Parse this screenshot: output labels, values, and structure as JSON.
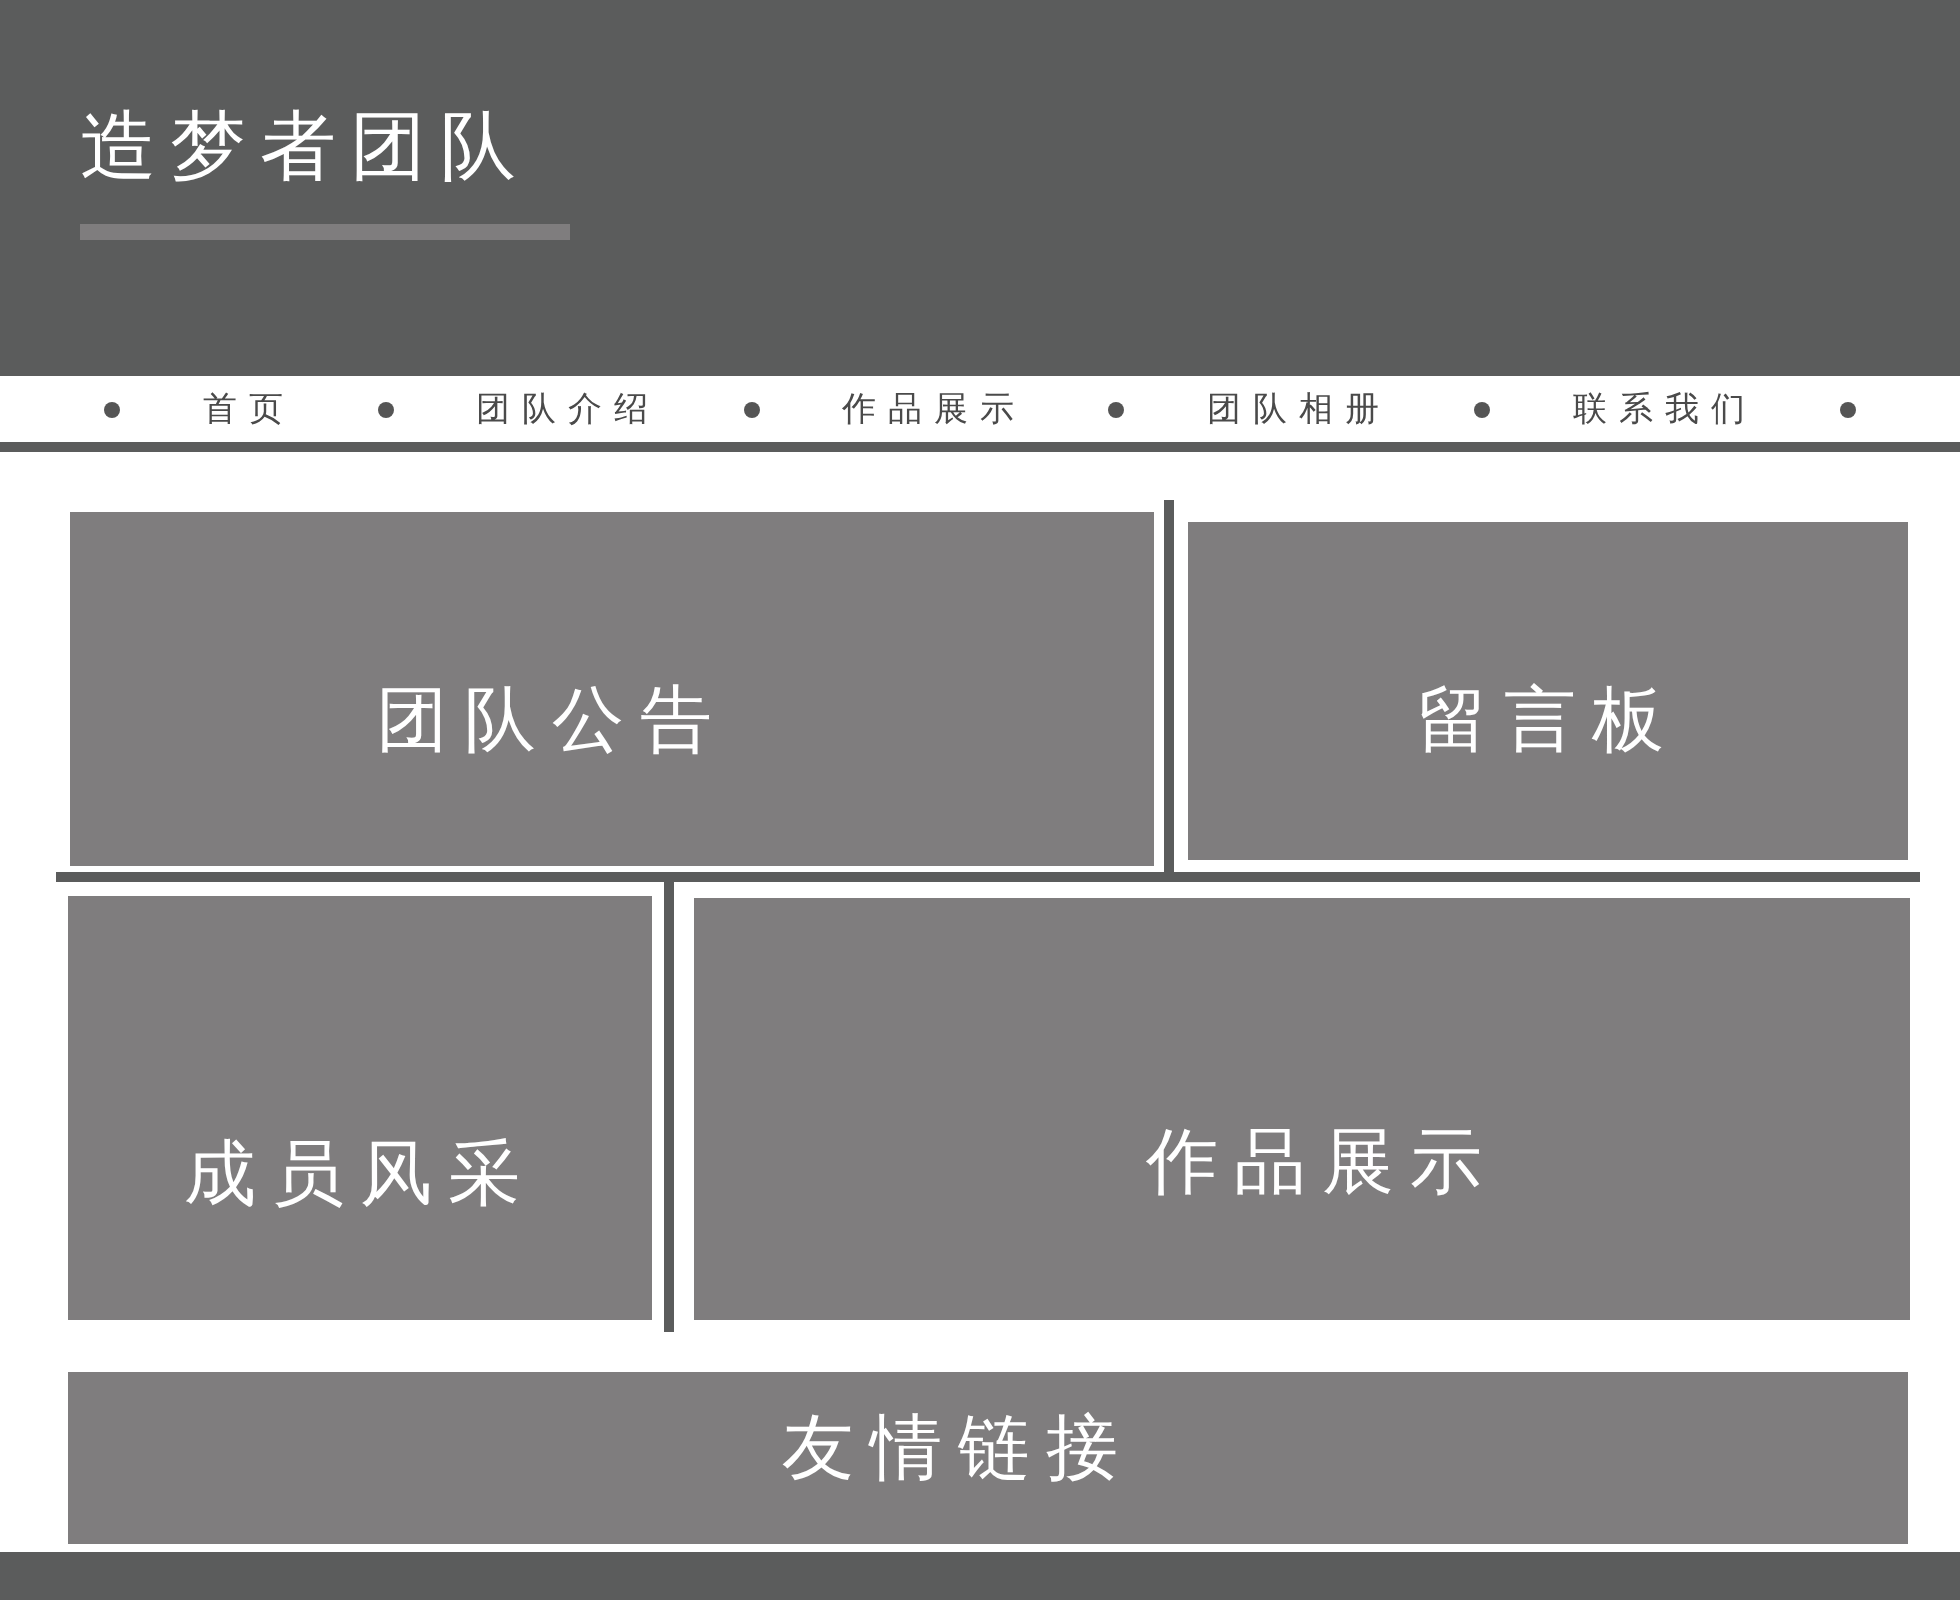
{
  "header": {
    "title": "造梦者团队"
  },
  "nav": {
    "items": [
      {
        "label": "首页"
      },
      {
        "label": "团队介绍"
      },
      {
        "label": "作品展示"
      },
      {
        "label": "团队相册"
      },
      {
        "label": "联系我们"
      }
    ]
  },
  "rows": [
    {
      "panels": [
        {
          "title": "团队公告"
        },
        {
          "title": "留言板"
        }
      ]
    },
    {
      "panels": [
        {
          "title": "成员风采"
        },
        {
          "title": "作品展示"
        }
      ]
    },
    {
      "panels": [
        {
          "title": "友情链接"
        }
      ]
    }
  ]
}
